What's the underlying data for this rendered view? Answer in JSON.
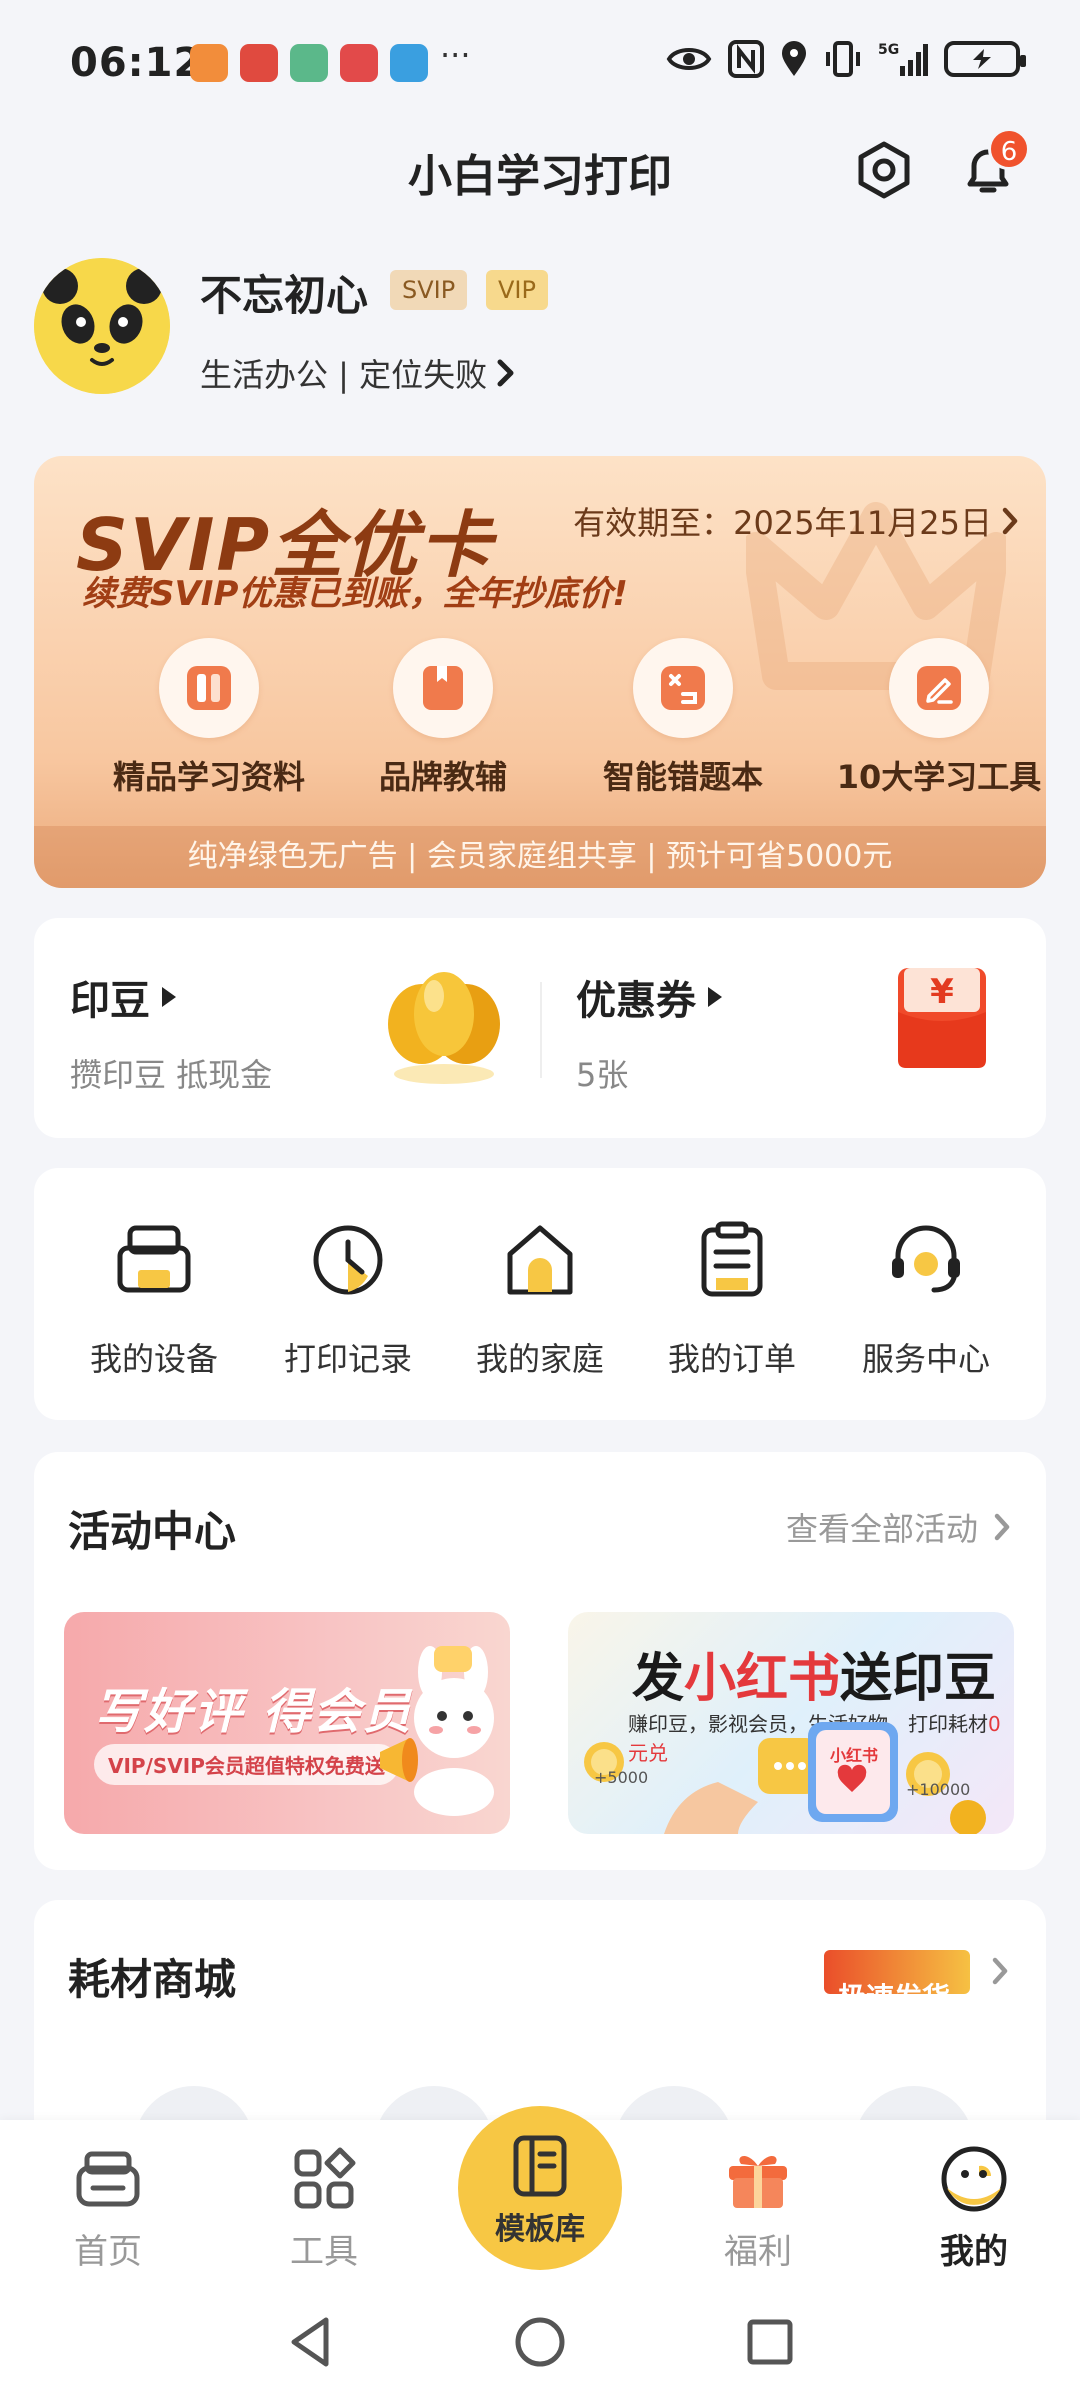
{
  "status_bar": {
    "time": "06:12",
    "more_dots": "···",
    "app_icon_colors": [
      "#f28d3b",
      "#e04a3f",
      "#5bb88a",
      "#e24a4a",
      "#3a9fe0"
    ]
  },
  "header": {
    "title": "小白学习打印",
    "notification_count": "6"
  },
  "profile": {
    "name": "不忘初心",
    "badges": [
      "SVIP",
      "VIP"
    ],
    "subtitle": "生活办公 | 定位失败"
  },
  "svip_card": {
    "title": "SVIP全优卡",
    "expiry": "有效期至：2025年11月25日",
    "slogan": "续费SVIP优惠已到账，全年抄底价!",
    "features": [
      {
        "label": "精品学习资料",
        "icon": "book-icon"
      },
      {
        "label": "品牌教辅",
        "icon": "bookmark-book-icon"
      },
      {
        "label": "智能错题本",
        "icon": "wrong-question-icon"
      },
      {
        "label": "10大学习工具",
        "icon": "edit-icon"
      }
    ],
    "footer": "纯净绿色无广告 | 会员家庭组共享 | 预计可省5000元"
  },
  "wallet": {
    "beans_title": "印豆",
    "beans_sub": "攒印豆 抵现金",
    "coupons_title": "优惠券",
    "coupons_sub": "5张",
    "coupon_symbol": "¥"
  },
  "quick_actions": [
    {
      "label": "我的设备",
      "icon": "printer-icon"
    },
    {
      "label": "打印记录",
      "icon": "clock-icon"
    },
    {
      "label": "我的家庭",
      "icon": "home-icon"
    },
    {
      "label": "我的订单",
      "icon": "clipboard-icon"
    },
    {
      "label": "服务中心",
      "icon": "headset-icon"
    }
  ],
  "activity": {
    "title": "活动中心",
    "view_all": "查看全部活动",
    "banner1_title": "写好评 得会员",
    "banner1_sub": "VIP/SVIP会员超值特权免费送",
    "banner2_title_a": "发",
    "banner2_title_b": "小红书",
    "banner2_title_c": "送印豆",
    "banner2_sub_a": "赚印豆，影视会员，生活好物，打印耗材",
    "banner2_sub_b": "0元兑",
    "banner2_amount_1": "+5000",
    "banner2_amount_2": "+10000",
    "banner2_app_label": "小红书"
  },
  "shop": {
    "title": "耗材商城",
    "tag": "极速发货"
  },
  "bottom_nav": [
    {
      "label": "首页",
      "icon": "printer-nav-icon"
    },
    {
      "label": "工具",
      "icon": "grid-icon"
    },
    {
      "label": "模板库",
      "icon": "template-icon"
    },
    {
      "label": "福利",
      "icon": "gift-icon"
    },
    {
      "label": "我的",
      "icon": "profile-face-icon"
    }
  ],
  "colors": {
    "accent_yellow": "#f7c744",
    "badge_red": "#f0522d",
    "svip_brown": "#8d3b12"
  }
}
